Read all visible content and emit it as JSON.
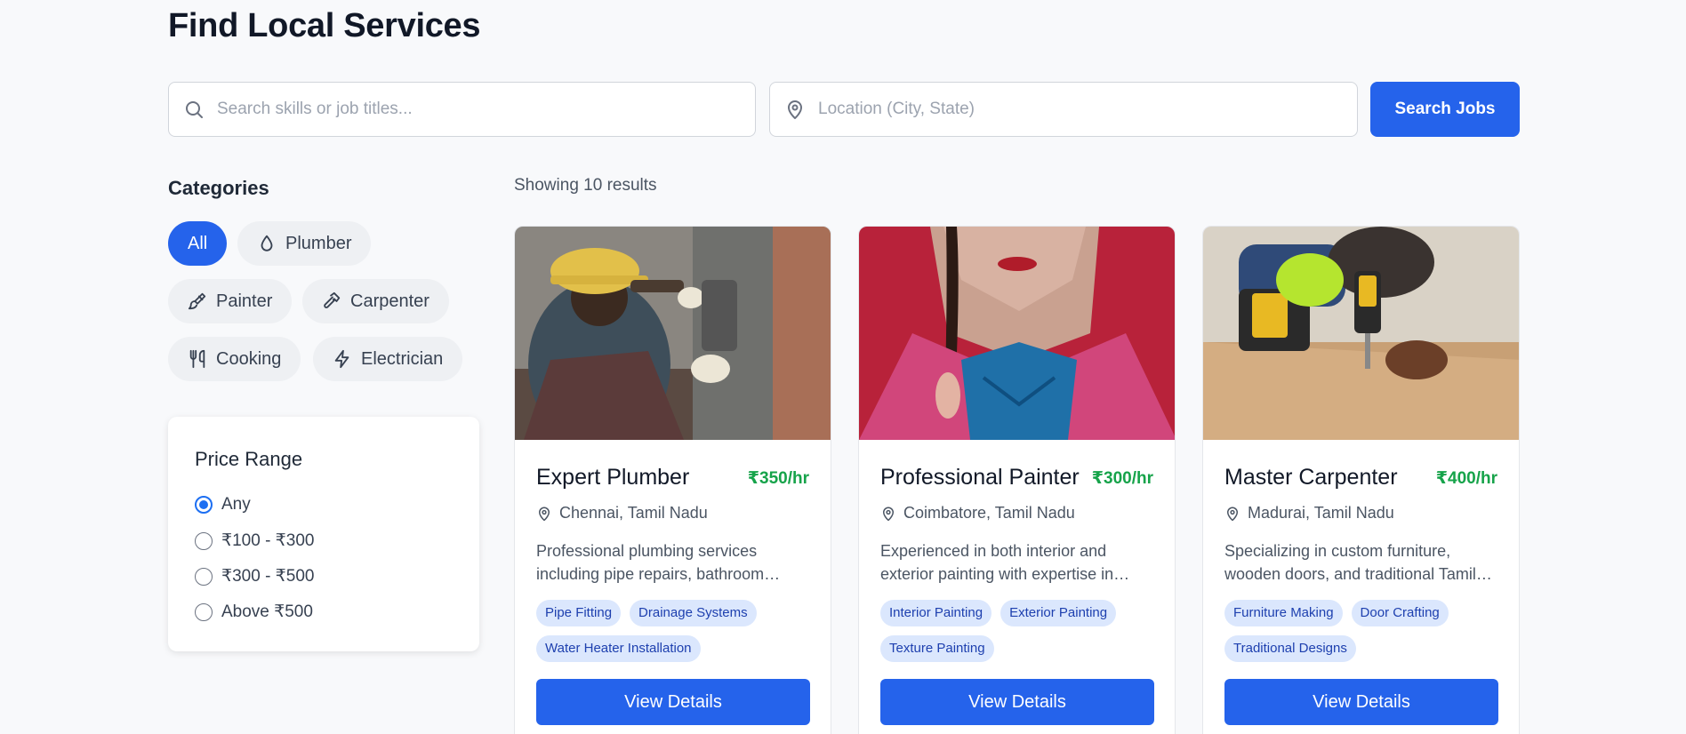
{
  "page": {
    "title": "Find Local Services"
  },
  "search": {
    "skills_placeholder": "Search skills or job titles...",
    "location_placeholder": "Location (City, State)",
    "button_label": "Search Jobs"
  },
  "categories": {
    "title": "Categories",
    "items": [
      {
        "label": "All",
        "icon": "none",
        "active": true
      },
      {
        "label": "Plumber",
        "icon": "droplet-icon",
        "active": false
      },
      {
        "label": "Painter",
        "icon": "paintbrush-icon",
        "active": false
      },
      {
        "label": "Carpenter",
        "icon": "hammer-icon",
        "active": false
      },
      {
        "label": "Cooking",
        "icon": "utensils-icon",
        "active": false
      },
      {
        "label": "Electrician",
        "icon": "bolt-icon",
        "active": false
      }
    ]
  },
  "price_range": {
    "title": "Price Range",
    "options": [
      {
        "label": "Any",
        "checked": true
      },
      {
        "label": "₹100 - ₹300",
        "checked": false
      },
      {
        "label": "₹300 - ₹500",
        "checked": false
      },
      {
        "label": "Above ₹500",
        "checked": false
      }
    ]
  },
  "results": {
    "count_text": "Showing 10 results"
  },
  "cards": [
    {
      "name": "Expert Plumber",
      "price": "₹350/hr",
      "location": "Chennai, Tamil Nadu",
      "description": "Professional plumbing services including pipe repairs, bathroom fittings and more.",
      "tags": [
        "Pipe Fitting",
        "Drainage Systems",
        "Water Heater Installation"
      ],
      "button": "View Details"
    },
    {
      "name": "Professional Painter",
      "price": "₹300/hr",
      "location": "Coimbatore, Tamil Nadu",
      "description": "Experienced in both interior and exterior painting with expertise in texture work.",
      "tags": [
        "Interior Painting",
        "Exterior Painting",
        "Texture Painting"
      ],
      "button": "View Details"
    },
    {
      "name": "Master Carpenter",
      "price": "₹400/hr",
      "location": "Madurai, Tamil Nadu",
      "description": "Specializing in custom furniture, wooden doors, and traditional Tamil designs.",
      "tags": [
        "Furniture Making",
        "Door Crafting",
        "Traditional Designs"
      ],
      "button": "View Details"
    }
  ],
  "colors": {
    "accent": "#2563eb",
    "price_green": "#16a34a",
    "tag_bg": "#dbe7fd",
    "tag_text": "#1e40af"
  }
}
